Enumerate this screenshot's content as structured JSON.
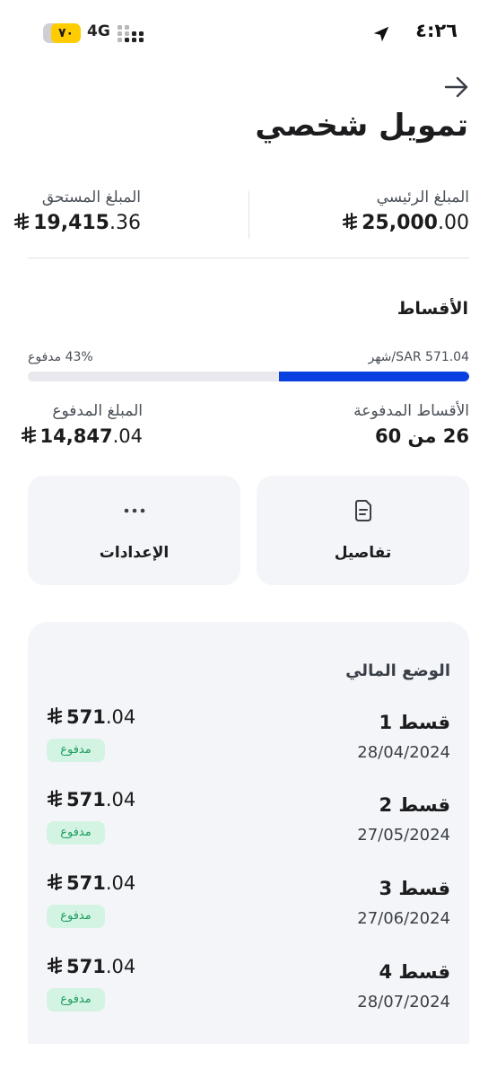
{
  "status_bar": {
    "time": "٤:٢٦",
    "network": "4G",
    "battery_level": "٧٠",
    "icons": [
      "location-arrow-icon",
      "signal-dots-icon",
      "battery-icon"
    ]
  },
  "header": {
    "back_icon": "arrow-right-icon",
    "title": "تمويل شخصي"
  },
  "summary": {
    "principal_label": "المبلغ الرئيسي",
    "principal_int": "25,000",
    "principal_dec": ".00",
    "due_label": "المبلغ المستحق",
    "due_int": "19,415",
    "due_dec": ".36",
    "currency_icon": "riyal-symbol-icon"
  },
  "installments": {
    "title": "الأقساط",
    "monthly_label": "شهر/SAR 571.04",
    "paid_percent_label": "43% مدفوع",
    "paid_fraction": 0.43,
    "paid_count_label": "الأقساط المدفوعة",
    "paid_count_value": "26 من 60",
    "paid_amount_label": "المبلغ المدفوع",
    "paid_amount_int": "14,847",
    "paid_amount_dec": ".04"
  },
  "actions": {
    "details_label": "تفاصيل",
    "details_icon": "document-icon",
    "settings_label": "الإعدادات",
    "settings_icon": "more-dots-icon"
  },
  "financial_status": {
    "title": "الوضع المالي",
    "items": [
      {
        "name": "قسط 1",
        "date": "28/04/2024",
        "amount_int": "571",
        "amount_dec": ".04",
        "status": "مدفوع"
      },
      {
        "name": "قسط 2",
        "date": "27/05/2024",
        "amount_int": "571",
        "amount_dec": ".04",
        "status": "مدفوع"
      },
      {
        "name": "قسط 3",
        "date": "27/06/2024",
        "amount_int": "571",
        "amount_dec": ".04",
        "status": "مدفوع"
      },
      {
        "name": "قسط 4",
        "date": "28/07/2024",
        "amount_int": "571",
        "amount_dec": ".04",
        "status": "مدفوع"
      }
    ]
  },
  "colors": {
    "accent": "#0a3fe0",
    "paid_badge_bg": "#d4f4e3",
    "paid_badge_text": "#1f9d60",
    "card_bg": "#f4f5f8",
    "battery": "#ffcc00"
  }
}
